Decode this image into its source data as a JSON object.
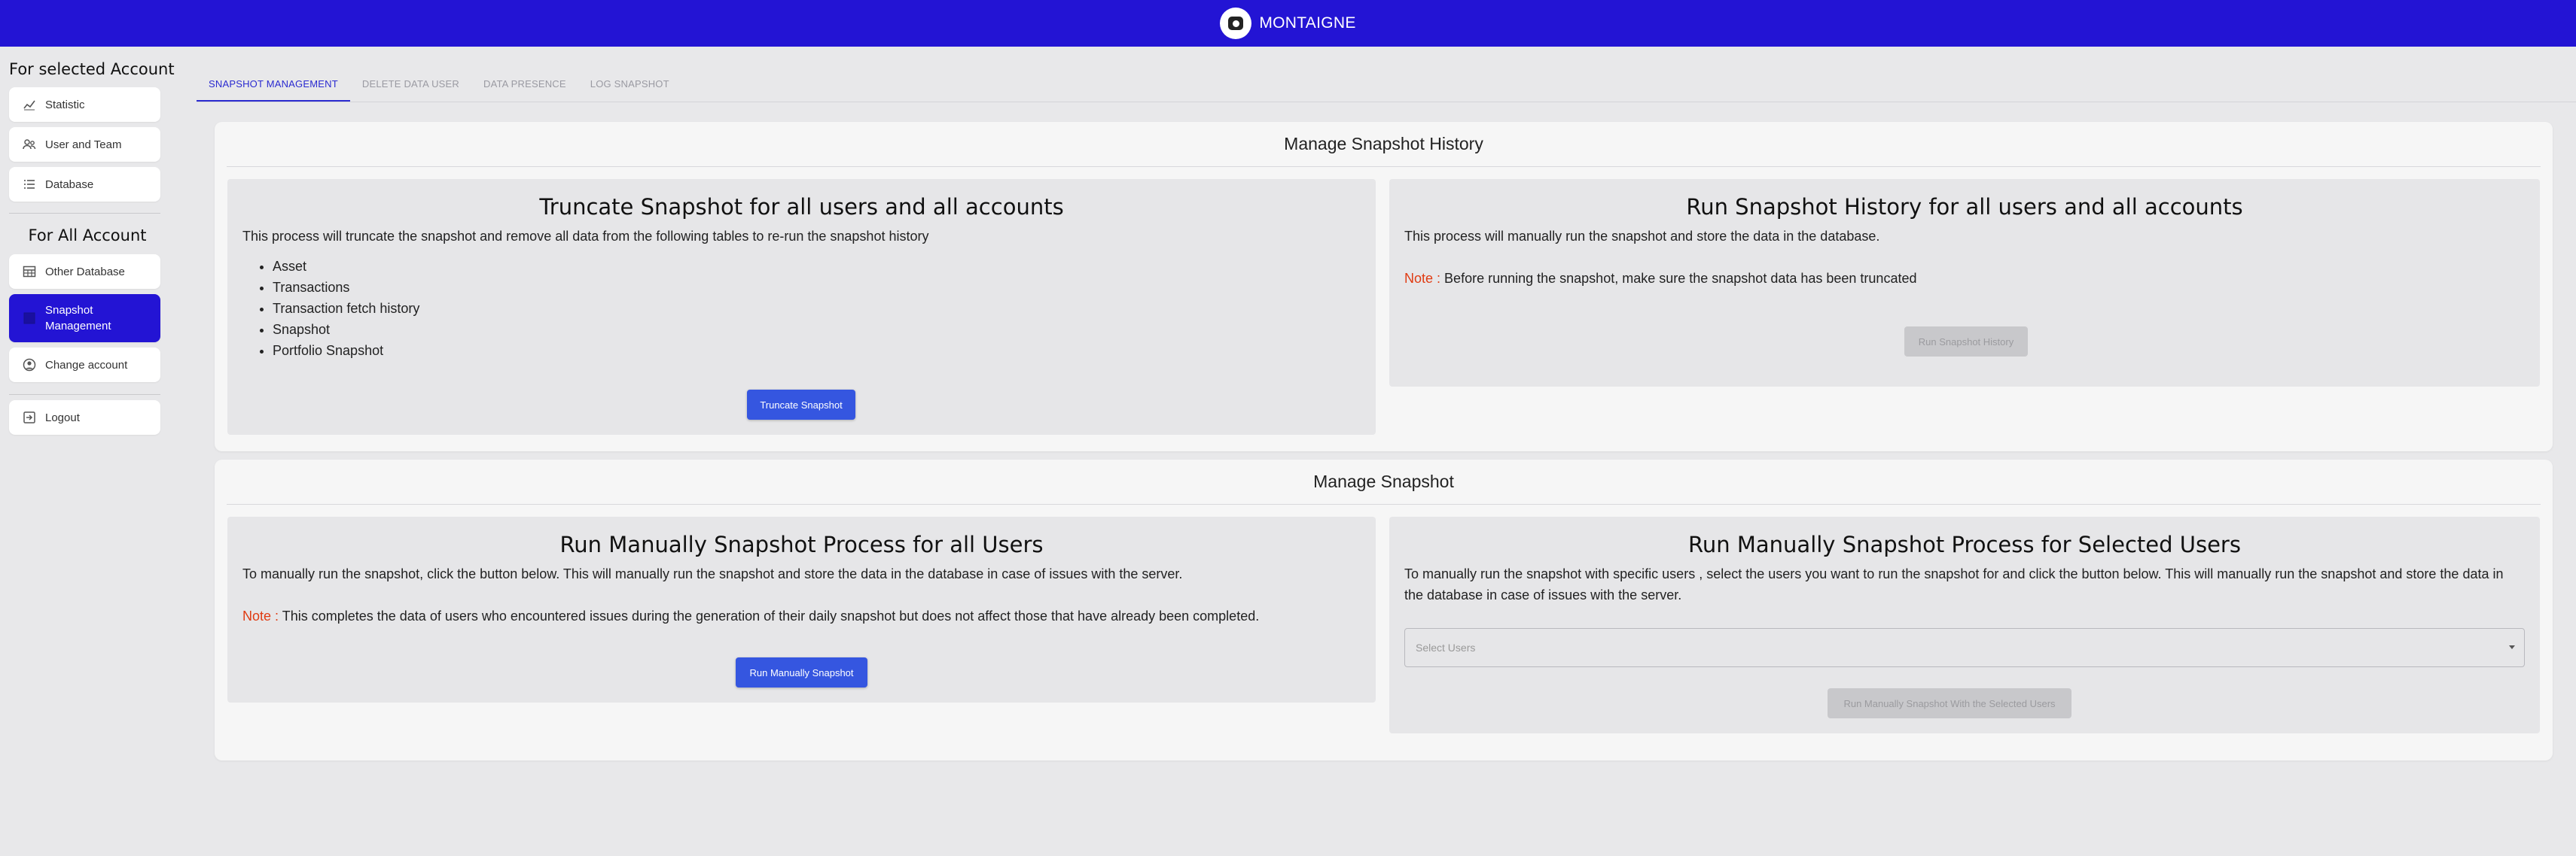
{
  "header": {
    "brand": "MONTAIGNE"
  },
  "sidebar": {
    "section1_title": "For selected Account",
    "section1_items": [
      {
        "label": "Statistic",
        "icon": "chart-line-icon"
      },
      {
        "label": "User and Team",
        "icon": "users-icon"
      },
      {
        "label": "Database",
        "icon": "list-icon"
      }
    ],
    "section2_title": "For All Account",
    "section2_items": [
      {
        "label": "Other Database",
        "icon": "table-icon"
      },
      {
        "label": "Snapshot Management",
        "icon": "snapshot-icon",
        "active": true
      },
      {
        "label": "Change account",
        "icon": "account-circle-icon"
      }
    ],
    "logout": {
      "label": "Logout",
      "icon": "logout-icon"
    }
  },
  "tabs": [
    {
      "label": "SNAPSHOT MANAGEMENT",
      "active": true
    },
    {
      "label": "DELETE DATA USER"
    },
    {
      "label": "DATA PRESENCE"
    },
    {
      "label": "LOG SNAPSHOT"
    }
  ],
  "history_panel": {
    "title": "Manage Snapshot History",
    "truncate_card": {
      "title": "Truncate Snapshot for all users and all accounts",
      "description": "This process will truncate the snapshot and remove all data from the following tables to re-run the snapshot history",
      "tables": [
        "Asset",
        "Transactions",
        "Transaction fetch history",
        "Snapshot",
        "Portfolio Snapshot"
      ],
      "button": "Truncate Snapshot"
    },
    "run_history_card": {
      "title": "Run Snapshot History for all users and all accounts",
      "description": "This process will manually run the snapshot and store the data in the database.",
      "note_label": "Note :",
      "note_text": "Before running the snapshot, make sure the snapshot data has been truncated",
      "button": "Run Snapshot History"
    }
  },
  "snapshot_panel": {
    "title": "Manage Snapshot",
    "all_users_card": {
      "title": "Run Manually Snapshot Process for all Users",
      "description": "To manually run the snapshot, click the button below. This will manually run the snapshot and store the data in the database in case of issues with the server.",
      "note_label": "Note :",
      "note_text": "This completes the data of users who encountered issues during the generation of their daily snapshot but does not affect those that have already been completed.",
      "button": "Run Manually Snapshot"
    },
    "selected_users_card": {
      "title": "Run Manually Snapshot Process for Selected Users",
      "description": "To manually run the snapshot with specific users , select the users you want to run the snapshot for and click the button below. This will manually run the snapshot and store the data in the database in case of issues with the server.",
      "select_placeholder": "Select Users",
      "button": "Run Manually Snapshot With the Selected Users"
    }
  }
}
